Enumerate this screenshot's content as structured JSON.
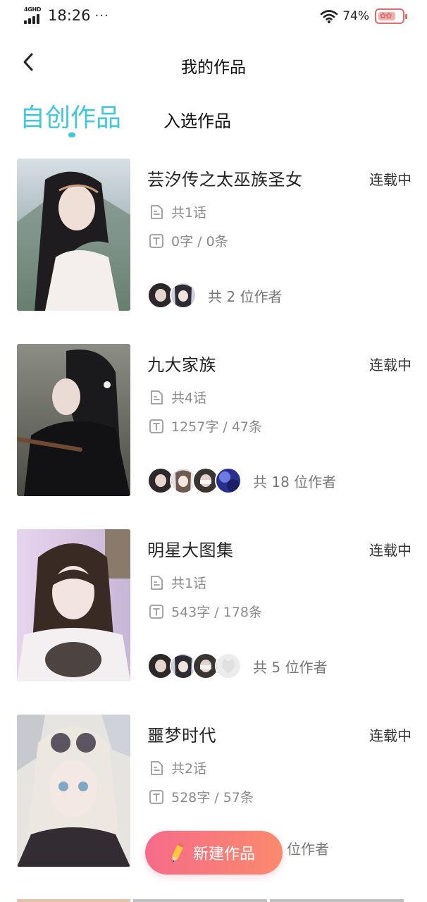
{
  "status_bar": {
    "network": "4GHD",
    "time": "18:26",
    "more": "···",
    "battery_percent": "74%",
    "battery_level": 0.74
  },
  "nav": {
    "title": "我的作品",
    "back_icon": "chevron-left-icon"
  },
  "tabs": [
    {
      "label": "自创作品",
      "active": true
    },
    {
      "label": "入选作品",
      "active": false
    }
  ],
  "works": [
    {
      "title": "芸汐传之太巫族圣女",
      "status": "连载中",
      "episodes": "共1话",
      "stats": "0字 / 0条",
      "authors_text": "共 2 位作者",
      "cover_colors": [
        "#c9d4dc",
        "#6b7c7a",
        "#f3efec"
      ]
    },
    {
      "title": "九大家族",
      "status": "连载中",
      "episodes": "共4话",
      "stats": "1257字 / 47条",
      "authors_text": "共 18 位作者",
      "cover_colors": [
        "#5c5f58",
        "#2a2b2b",
        "#8d8e86"
      ]
    },
    {
      "title": "明星大图集",
      "status": "连载中",
      "episodes": "共1话",
      "stats": "543字 / 178条",
      "authors_text": "共 5 位作者",
      "cover_colors": [
        "#d9c8e6",
        "#3a2d28",
        "#e9e4ea"
      ]
    },
    {
      "title": "噩梦时代",
      "status": "连载中",
      "episodes": "共2话",
      "stats": "528字 / 57条",
      "authors_text": "位作者",
      "cover_colors": [
        "#e8e6e3",
        "#c9ccd5",
        "#46404a"
      ]
    }
  ],
  "fab": {
    "label": "新建作品",
    "icon": "pencil-icon"
  },
  "colors": {
    "accent": "#41c8d8",
    "fab_start": "#f56b8a",
    "fab_end": "#fa8a6c"
  }
}
